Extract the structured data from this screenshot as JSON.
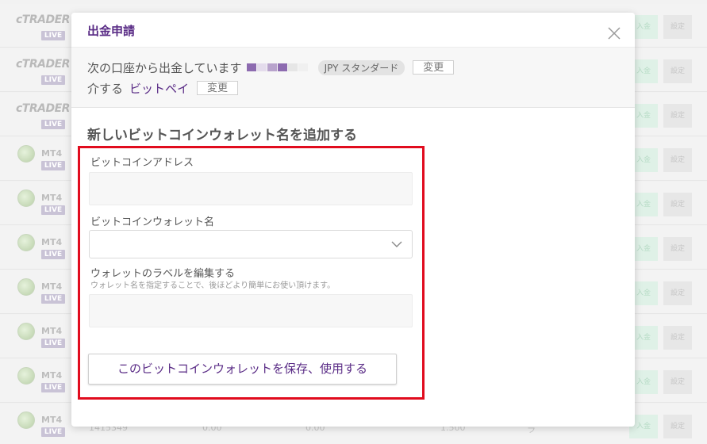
{
  "modal": {
    "title": "出金申請",
    "info": {
      "from_text": "次の口座から出金しています",
      "account_type": "JPY スタンダード",
      "change_label": "変更",
      "via_text": "介する",
      "method": "ビットペイ",
      "method_change_label": "変更"
    },
    "section_title": "新しいビットコインウォレット名を追加する",
    "form": {
      "address_label": "ビットコインアドレス",
      "address_value": "",
      "wallet_name_label": "ビットコインウォレット名",
      "wallet_name_value": "",
      "edit_label": "ウォレットのラベルを編集する",
      "edit_help": "ウォレット名を指定することで、後ほどより簡単にお使い頂けます。",
      "edit_value": "",
      "save_label": "このビットコインウォレットを保存、使用する"
    }
  },
  "background": {
    "rows": [
      {
        "platform": "cTRADER",
        "badge": "LIVE"
      },
      {
        "platform": "cTRADER",
        "badge": "LIVE"
      },
      {
        "platform": "cTRADER",
        "badge": "LIVE"
      },
      {
        "platform": "MT4",
        "badge": "LIVE"
      },
      {
        "platform": "MT4",
        "badge": "LIVE"
      },
      {
        "platform": "MT4",
        "badge": "LIVE"
      },
      {
        "platform": "MT4",
        "badge": "LIVE"
      },
      {
        "platform": "MT4",
        "badge": "LIVE"
      },
      {
        "platform": "MT4",
        "badge": "LIVE"
      },
      {
        "platform": "MT4",
        "badge": "LIVE"
      }
    ],
    "deposit_label": "入金",
    "settings_label": "設定",
    "partial_row": [
      "1415349",
      "0.00",
      "0.00",
      "1.500",
      "ラ"
    ]
  },
  "colors": {
    "brand_purple": "#5a2c86",
    "highlight_red": "#e10c1e",
    "deposit_bg": "#dff1e7"
  }
}
